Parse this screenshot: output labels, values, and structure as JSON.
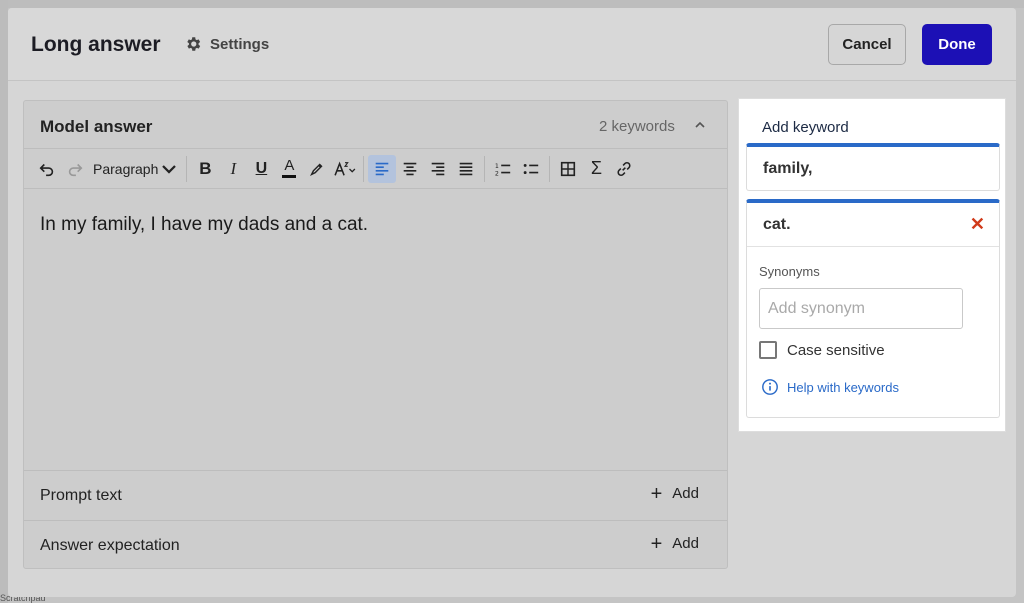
{
  "modal": {
    "title": "Long answer",
    "settings_label": "Settings",
    "cancel_label": "Cancel",
    "done_label": "Done"
  },
  "editor": {
    "card_title": "Model answer",
    "keyword_count": "2 keywords",
    "paragraph_select": "Paragraph",
    "toolbar": {
      "bold": "B",
      "italic": "I",
      "underline": "U",
      "text_color": "A",
      "sigma": "Σ"
    },
    "content": "In my family, I have my dads and a cat."
  },
  "rows": [
    {
      "label": "Prompt text",
      "action": "Add"
    },
    {
      "label": "Answer expectation",
      "action": "Add"
    }
  ],
  "keywords_panel": {
    "add_keyword": "Add keyword",
    "keywords": [
      {
        "text": "family,"
      },
      {
        "text": "cat."
      }
    ],
    "synonyms_label": "Synonyms",
    "synonym_placeholder": "Add synonym",
    "case_sensitive_label": "Case sensitive",
    "help_link": "Help with keywords"
  },
  "background": {
    "bottom_text": "Scratchpad"
  },
  "colors": {
    "primary": "#1c10b5",
    "accent_blue": "#2a6ac8",
    "close_red": "#d03a1a"
  }
}
